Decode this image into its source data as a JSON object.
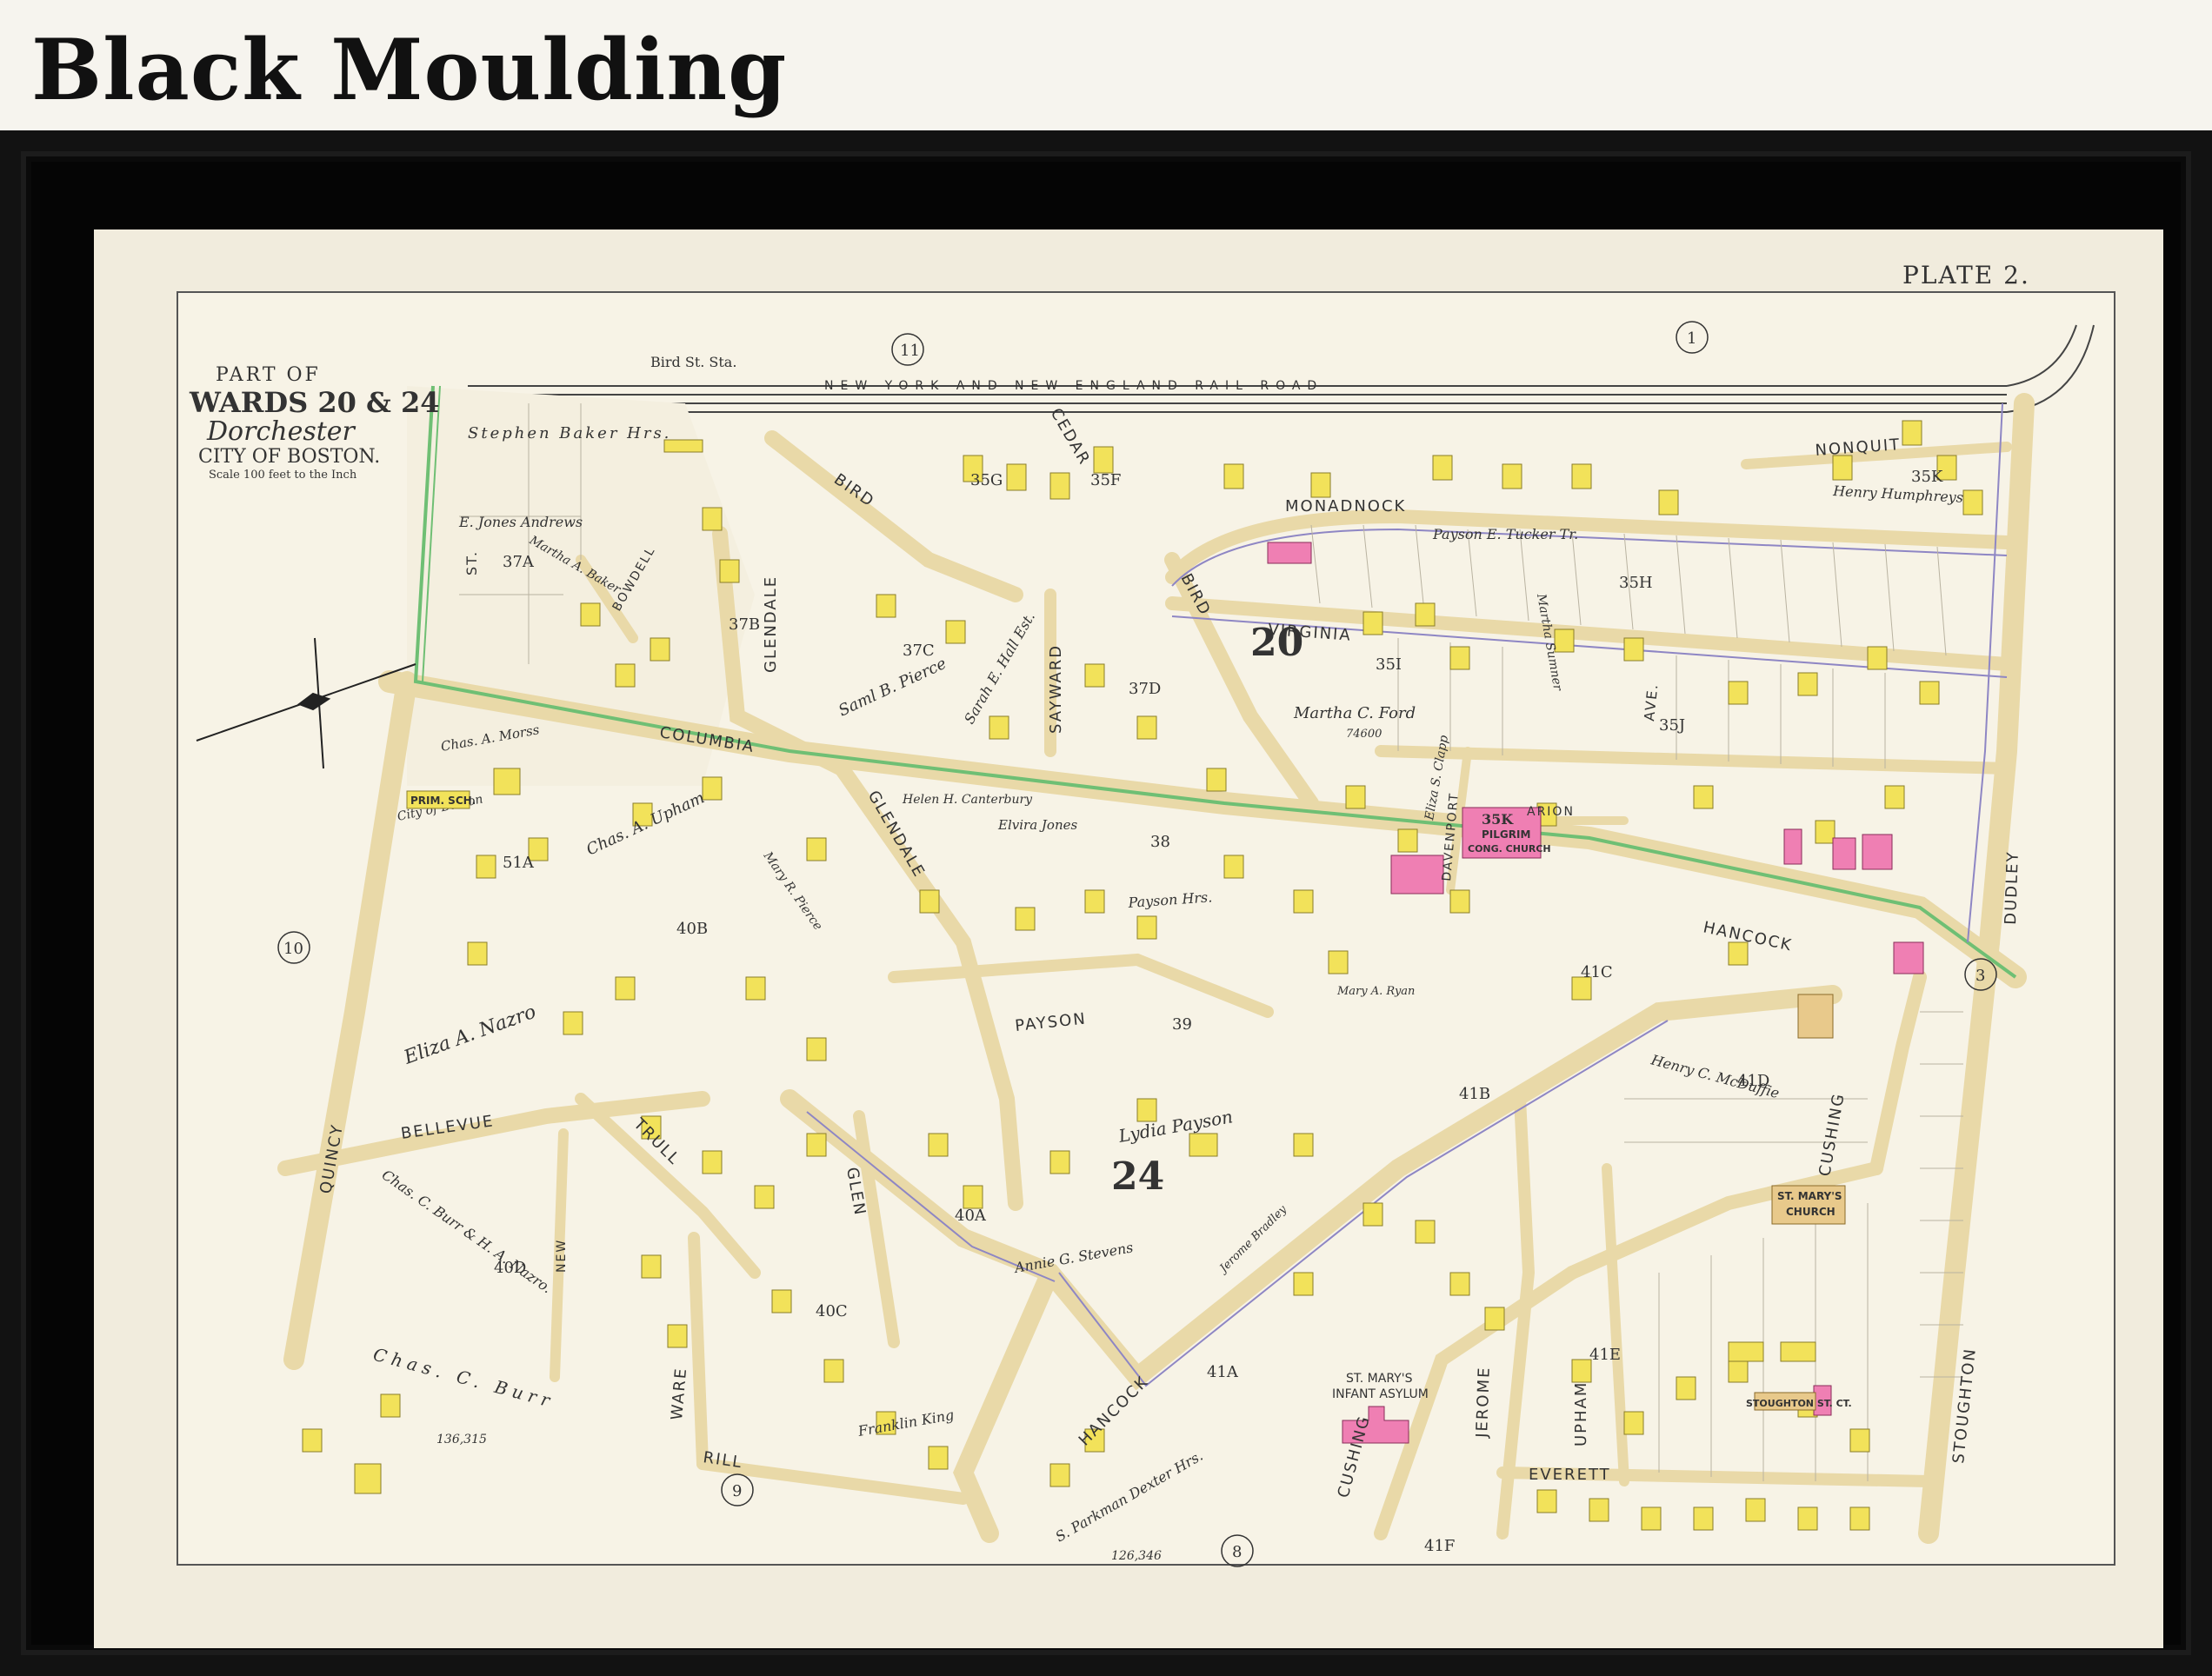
{
  "heading": "Black Moulding",
  "map": {
    "plate": "PLATE 2.",
    "title": {
      "line1": "PART OF",
      "line2": "WARDS 20 & 24",
      "line3": "Dorchester",
      "line4": "CITY OF BOSTON.",
      "scale": "Scale 100 feet to the Inch"
    },
    "railroad": "NEW YORK AND NEW ENGLAND RAIL ROAD",
    "station": "Bird St. Sta.",
    "ward_numbers": [
      "20",
      "24"
    ],
    "adjoining_plates": [
      "11",
      "1",
      "10",
      "3",
      "9",
      "8"
    ],
    "block_labels": [
      "35G",
      "35F",
      "35H",
      "35I",
      "35J",
      "35K",
      "37A",
      "37B",
      "37C",
      "37D",
      "38",
      "39",
      "40A",
      "40B",
      "40C",
      "40D",
      "41A",
      "41B",
      "41C",
      "41D",
      "41E",
      "41F",
      "51A"
    ],
    "streets": {
      "columbia": "COLUMBIA",
      "hancock_north": "HANCOCK",
      "hancock_south": "HANCOCK",
      "glendale_north": "GLENDALE",
      "glendale_south": "GLENDALE",
      "sayward": "SAYWARD",
      "bird_north": "BIRD",
      "bird_east": "BIRD",
      "cedar": "CEDAR",
      "monadnock": "MONADNOCK",
      "virginia": "VIRGINIA",
      "nonquit": "NONQUIT",
      "dudley": "DUDLEY",
      "stoughton": "STOUGHTON",
      "quincy": "QUINCY",
      "bellevue": "BELLEVUE",
      "trull": "TRULL",
      "ware": "WARE",
      "rill": "RILL",
      "glen": "GLEN",
      "payson": "PAYSON",
      "cushing_north": "CUSHING",
      "cushing_south": "CUSHING",
      "jerome": "JEROME",
      "upham": "UPHAM",
      "everett": "EVERETT",
      "davenport": "DAVENPORT",
      "arion": "ARION",
      "bowdell": "BOWDELL",
      "new": "NEW",
      "ave": "AVE.",
      "st": "ST."
    },
    "owners": {
      "stephen_baker": "Stephen Baker Hrs.",
      "e_jones_andrews": "E. Jones Andrews",
      "martha_baker": "Martha A. Baker",
      "chas_morss": "Chas. A. Morss",
      "chas_upham": "Chas. A. Upham",
      "city_of_boston": "City of Boston",
      "eliza_nazro": "Eliza A. Nazro",
      "chas_burr_nazro": "Chas. C. Burr & H. A. Nazro.",
      "chas_burr": "Chas. C. Burr",
      "sarah_hall": "Sarah E. Hall Est.",
      "saml_pierce": "Saml B. Pierce",
      "martha_ford": "Martha C. Ford",
      "helen_canterbury": "Helen H. Canterbury",
      "elvira_jones": "Elvira Jones",
      "mary_pierce": "Mary R. Pierce",
      "payson_hrs": "Payson Hrs.",
      "lydia_payson": "Lydia Payson",
      "annie_stevens": "Annie G. Stevens",
      "franklin_king": "Franklin King",
      "parkman_dexter": "S. Parkman Dexter Hrs.",
      "henry_humphreys": "Henry Humphreys",
      "martha_sumner": "Martha Sumner",
      "henry_mcduffie": "Henry C. McDuffie",
      "mary_ryan": "Mary A. Ryan",
      "eliza_clapp": "Eliza S. Clapp",
      "payson_tucker": "Payson E. Tucker Tr.",
      "jerome_bradley": "Jerome Bradley",
      "area_burr": "136,315",
      "area_dexter": "126,346",
      "area_ford": "74600"
    },
    "institutions": {
      "prim_sch": "PRIM. SCH.",
      "pilgrim_1": "35K",
      "pilgrim_2": "PILGRIM",
      "pilgrim_3": "CONG. CHURCH",
      "st_marys_church_1": "ST. MARY'S",
      "st_marys_church_2": "CHURCH",
      "asylum_1": "ST. MARY'S",
      "asylum_2": "INFANT ASYLUM",
      "stoughton_st_ct": "STOUGHTON ST. CT."
    }
  }
}
